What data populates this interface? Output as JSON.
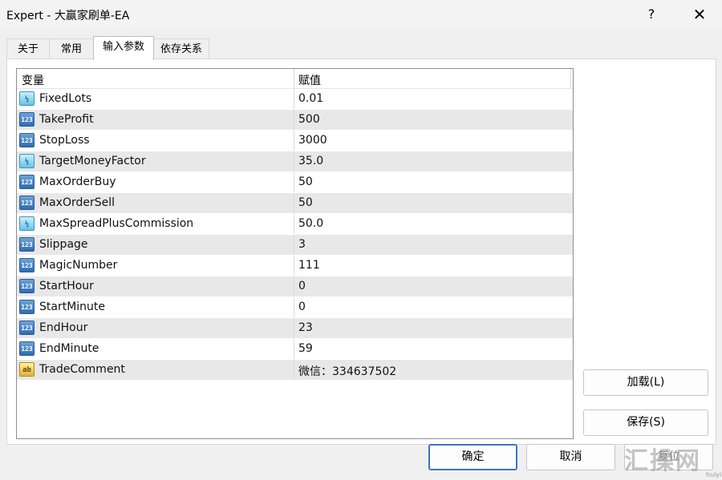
{
  "window": {
    "title": "Expert - 大赢家刷单-EA",
    "help": "?",
    "close": "✕"
  },
  "tabs": [
    "关于",
    "常用",
    "输入参数",
    "依存关系"
  ],
  "grid": {
    "col_variable": "变量",
    "col_value": "赋值",
    "rows": [
      {
        "type": "double",
        "icon": "½",
        "name": "FixedLots",
        "value": "0.01"
      },
      {
        "type": "int",
        "icon": "123",
        "name": "TakeProfit",
        "value": "500"
      },
      {
        "type": "int",
        "icon": "123",
        "name": "StopLoss",
        "value": "3000"
      },
      {
        "type": "double",
        "icon": "½",
        "name": "TargetMoneyFactor",
        "value": "35.0"
      },
      {
        "type": "int",
        "icon": "123",
        "name": "MaxOrderBuy",
        "value": "50"
      },
      {
        "type": "int",
        "icon": "123",
        "name": "MaxOrderSell",
        "value": "50"
      },
      {
        "type": "double",
        "icon": "½",
        "name": "MaxSpreadPlusCommission",
        "value": "50.0"
      },
      {
        "type": "int",
        "icon": "123",
        "name": "Slippage",
        "value": "3"
      },
      {
        "type": "int",
        "icon": "123",
        "name": "MagicNumber",
        "value": "111"
      },
      {
        "type": "int",
        "icon": "123",
        "name": "StartHour",
        "value": "0"
      },
      {
        "type": "int",
        "icon": "123",
        "name": "StartMinute",
        "value": "0"
      },
      {
        "type": "int",
        "icon": "123",
        "name": "EndHour",
        "value": "23"
      },
      {
        "type": "int",
        "icon": "123",
        "name": "EndMinute",
        "value": "59"
      },
      {
        "type": "string",
        "icon": "ab",
        "name": "TradeComment",
        "value": "微信：334637502"
      }
    ]
  },
  "buttons": {
    "load": "加载(L)",
    "save": "保存(S)",
    "ok": "确定",
    "cancel": "取消",
    "reset": "复位"
  },
  "watermark": {
    "text": "汇操网",
    "url": "huiyi.net"
  }
}
